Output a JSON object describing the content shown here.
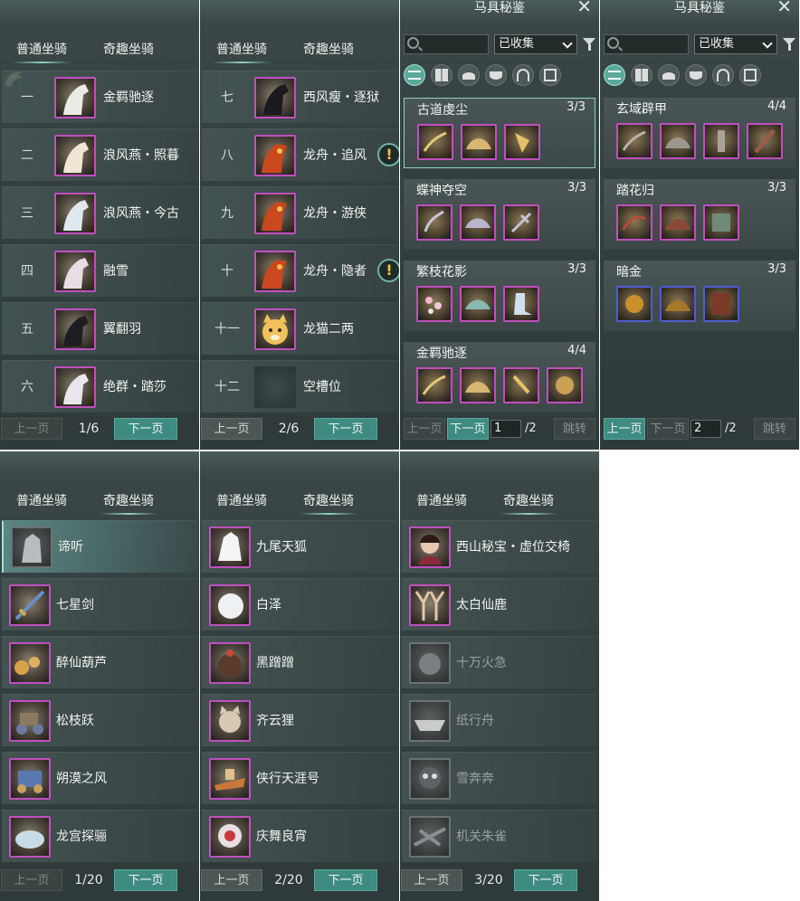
{
  "tabs": {
    "normal": "普通坐骑",
    "fun": "奇趣坐骑"
  },
  "pagers": {
    "prev": "上一页",
    "next": "下一页",
    "p1": "1/6",
    "p2": "2/6",
    "p3": "1/20",
    "p4": "2/20",
    "p5": "3/20"
  },
  "panel1": {
    "rows": [
      {
        "num": "一",
        "name": "金羁驰逐"
      },
      {
        "num": "二",
        "name": "浪风燕・照暮"
      },
      {
        "num": "三",
        "name": "浪风燕・今古"
      },
      {
        "num": "四",
        "name": "融雪"
      },
      {
        "num": "五",
        "name": "翼翻羽"
      },
      {
        "num": "六",
        "name": "绝群・踏莎"
      }
    ]
  },
  "panel2": {
    "rows": [
      {
        "num": "七",
        "name": "西风瘦・逐狱"
      },
      {
        "num": "八",
        "name": "龙舟・追风"
      },
      {
        "num": "九",
        "name": "龙舟・游侠"
      },
      {
        "num": "十",
        "name": "龙舟・隐者"
      },
      {
        "num": "十一",
        "name": "龙猫二两"
      },
      {
        "num": "十二",
        "name": "空槽位"
      }
    ],
    "alert": "!"
  },
  "codex": {
    "title": "马具秘鉴",
    "close": "✕",
    "filter": "已收集",
    "search_placeholder": "",
    "jump": "跳转",
    "page_a": "1",
    "page_b": "2",
    "total": "/2",
    "groups_a": [
      {
        "name": "古道虔尘",
        "count": "3/3"
      },
      {
        "name": "蝶神夺空",
        "count": "3/3"
      },
      {
        "name": "繁枝花影",
        "count": "3/3"
      },
      {
        "name": "金羁驰逐",
        "count": "4/4"
      }
    ],
    "groups_b": [
      {
        "name": "玄域辟甲",
        "count": "4/4"
      },
      {
        "name": "踏花归",
        "count": "3/3"
      },
      {
        "name": "暗金",
        "count": "3/3"
      }
    ]
  },
  "panel3": {
    "rows": [
      "谛听",
      "七星剑",
      "醉仙葫芦",
      "松枝跃",
      "朔漠之风",
      "龙宫探骊"
    ]
  },
  "panel4": {
    "rows": [
      "九尾天狐",
      "白泽",
      "黑蹭蹭",
      "齐云狸",
      "侠行天涯号",
      "庆舞良宵"
    ]
  },
  "panel5": {
    "rows": [
      "西山秘宝・虚位交椅",
      "太白仙鹿",
      "十万火急",
      "纸行舟",
      "雪奔奔",
      "机关朱雀"
    ]
  },
  "colors": {
    "accent": "#3d8b81",
    "frame": "#c14fc0",
    "frame_blue": "#4c5ed2",
    "bg": "#34403f"
  }
}
